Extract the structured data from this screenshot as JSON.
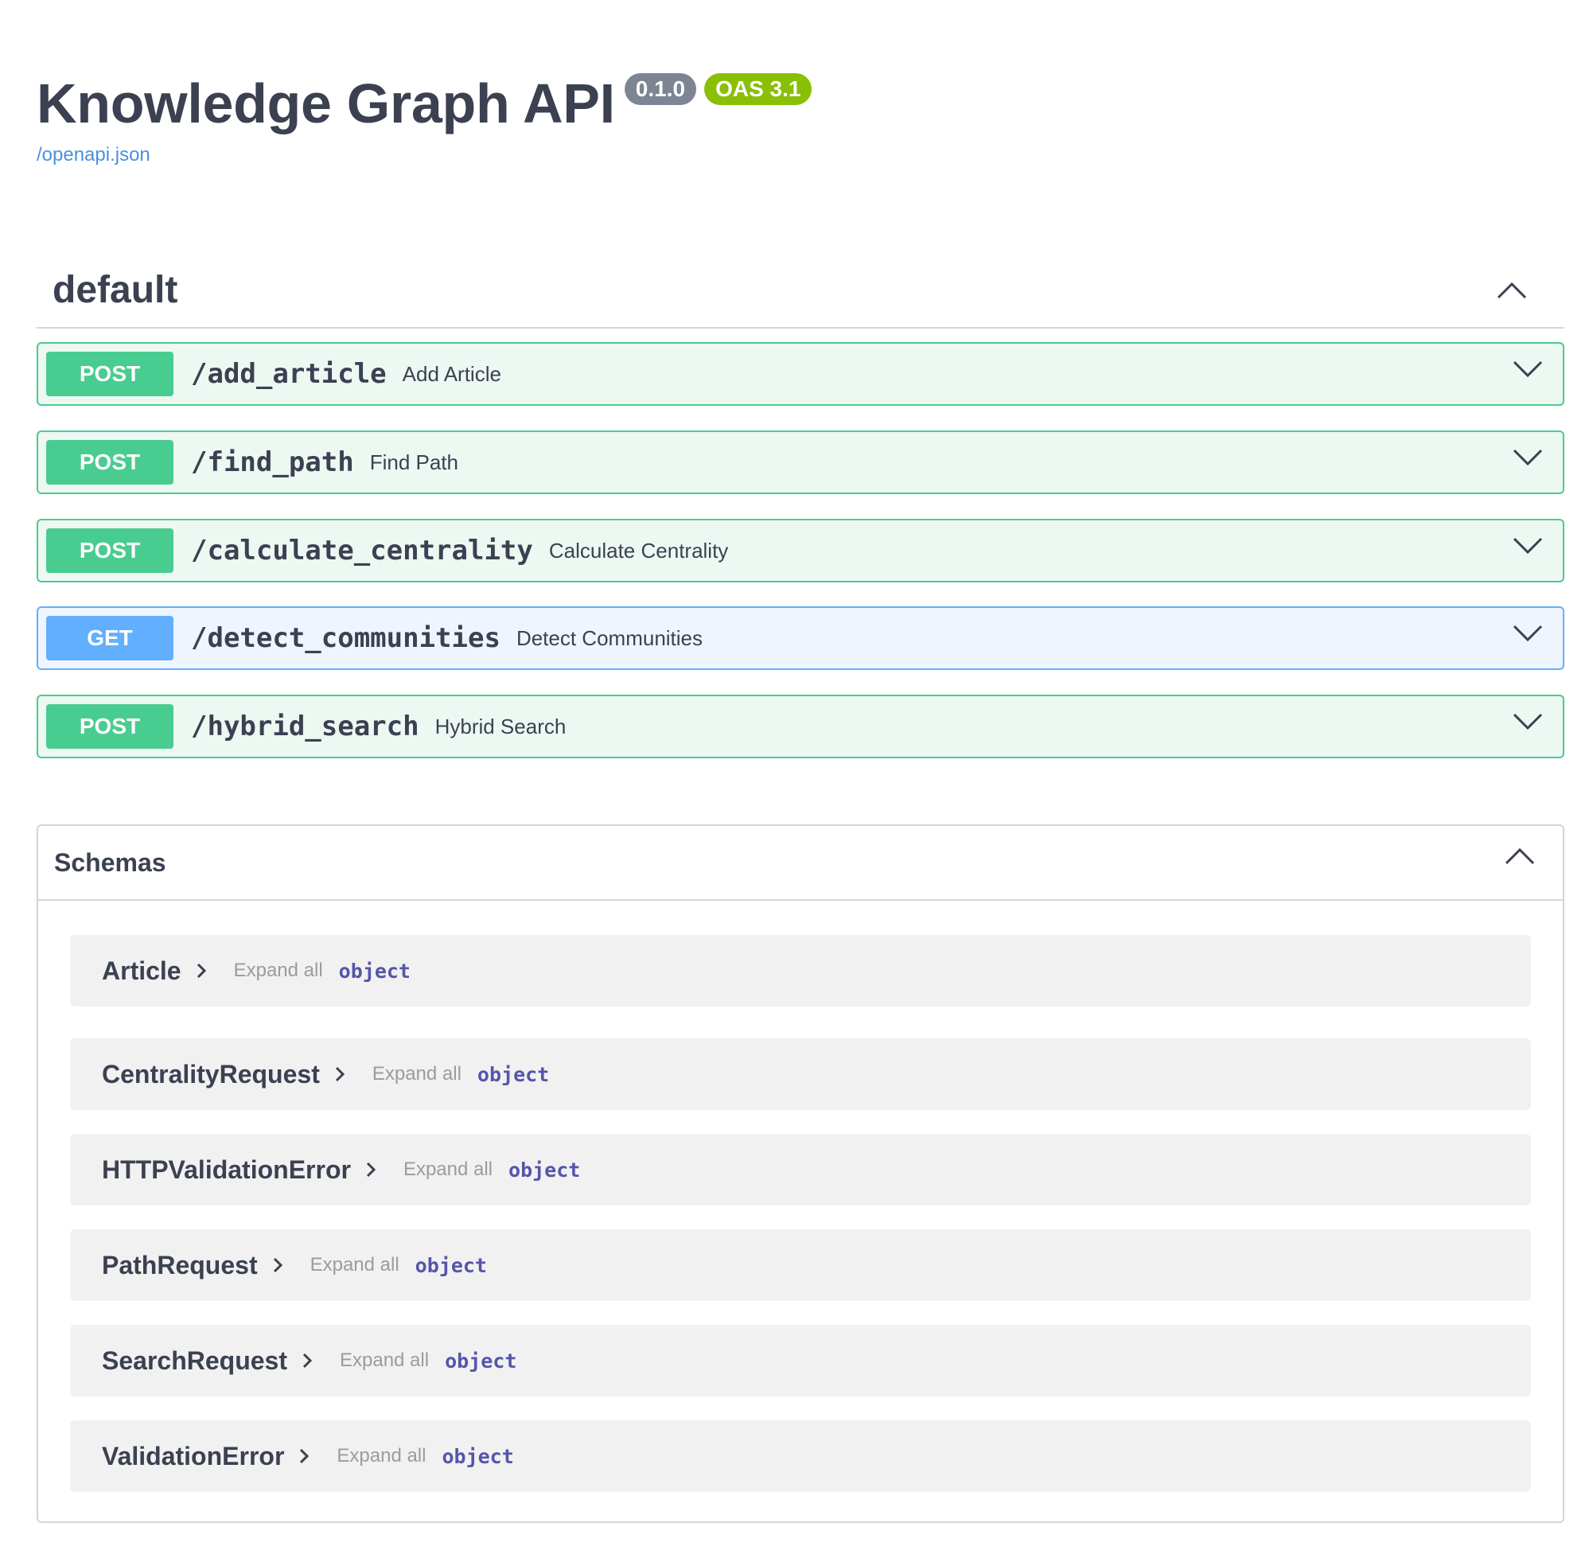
{
  "info": {
    "title": "Knowledge Graph API",
    "version": "0.1.0",
    "oas": "OAS 3.1",
    "spec_link": "/openapi.json"
  },
  "tag": {
    "name": "default"
  },
  "operations": [
    {
      "method": "POST",
      "path": "/add_article",
      "summary": "Add Article"
    },
    {
      "method": "POST",
      "path": "/find_path",
      "summary": "Find Path"
    },
    {
      "method": "POST",
      "path": "/calculate_centrality",
      "summary": "Calculate Centrality"
    },
    {
      "method": "GET",
      "path": "/detect_communities",
      "summary": "Detect Communities"
    },
    {
      "method": "POST",
      "path": "/hybrid_search",
      "summary": "Hybrid Search"
    }
  ],
  "schemas": {
    "title": "Schemas",
    "expand_label": "Expand all",
    "items": [
      {
        "name": "Article",
        "type": "object"
      },
      {
        "name": "CentralityRequest",
        "type": "object"
      },
      {
        "name": "HTTPValidationError",
        "type": "object"
      },
      {
        "name": "PathRequest",
        "type": "object"
      },
      {
        "name": "SearchRequest",
        "type": "object"
      },
      {
        "name": "ValidationError",
        "type": "object"
      }
    ]
  },
  "colors": {
    "post": "#49cc90",
    "get": "#61affe",
    "link": "#4990e2",
    "version_badge": "#7d8492",
    "oas_badge": "#89bf04"
  }
}
